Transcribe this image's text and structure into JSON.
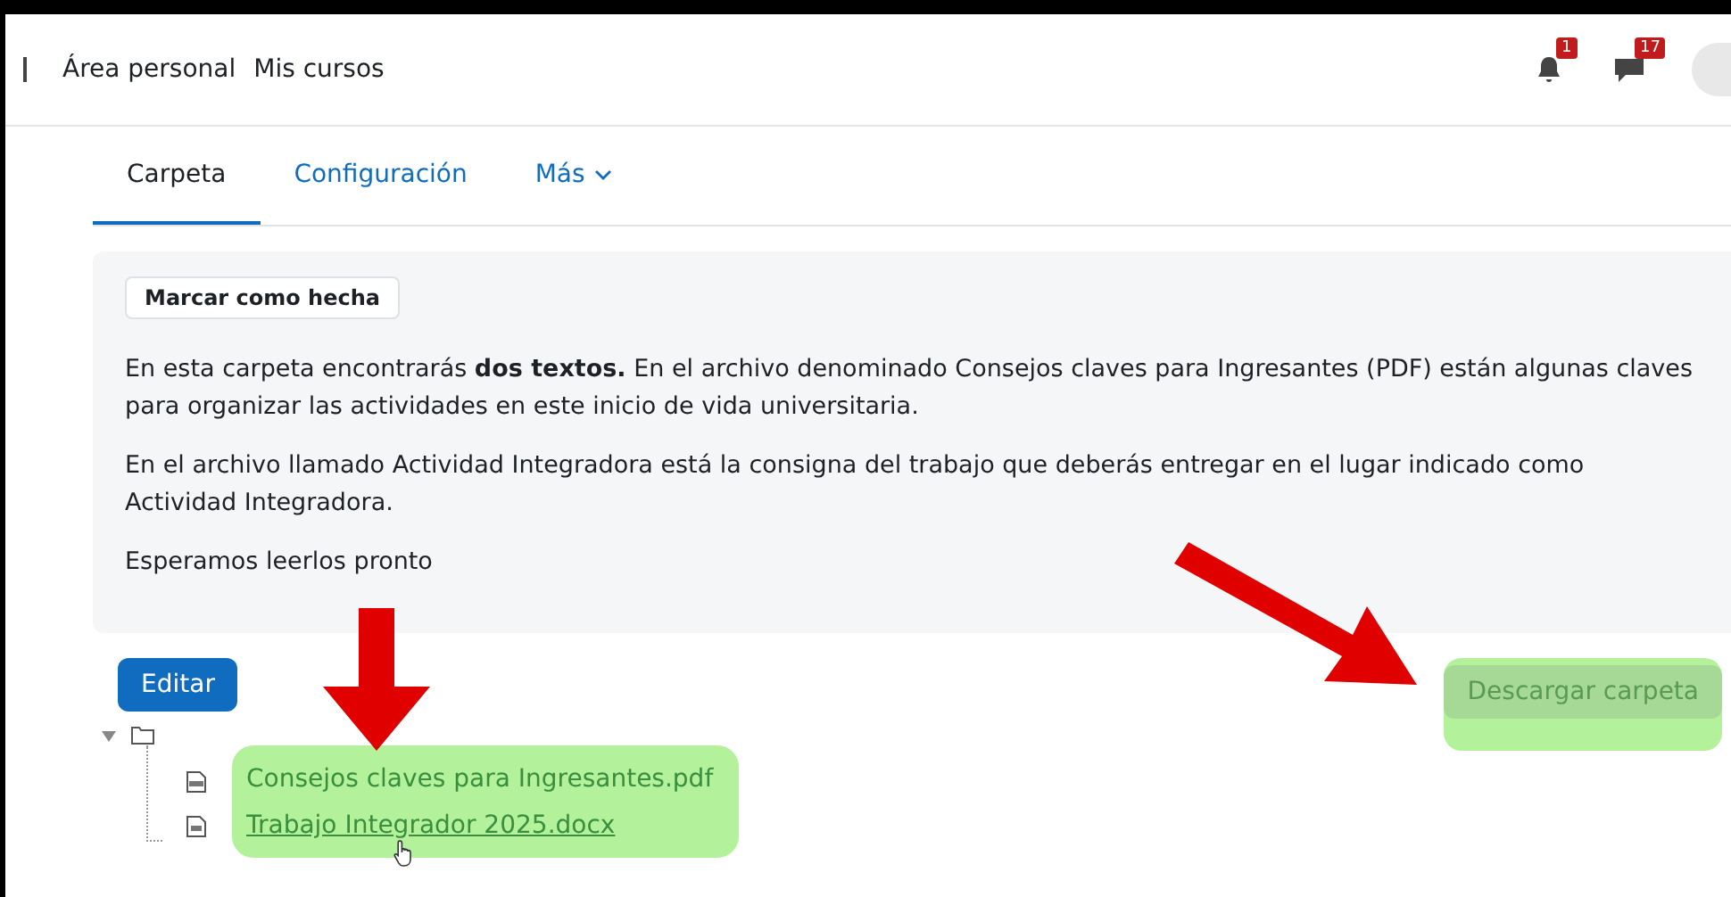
{
  "nav": {
    "links": [
      "Área personal",
      "Mis cursos"
    ],
    "notifications": {
      "count": "1"
    },
    "messages": {
      "count": "17"
    }
  },
  "tabs": [
    {
      "label": "Carpeta",
      "selected": true,
      "kind": "link"
    },
    {
      "label": "Configuración",
      "selected": false,
      "kind": "link"
    },
    {
      "label": "Más",
      "selected": false,
      "kind": "menu"
    }
  ],
  "mark_done_button": "Marcar como hecha",
  "description": [
    "En esta carpeta encontrarás **dos textos.** En el archivo denominado Consejos claves para Ingresantes (PDF) están algunas claves para organizar las actividades en este inicio de vida universitaria.",
    "En el archivo llamado Actividad Integradora está la consigna del trabajo que deberás entregar en el lugar indicado como Actividad Integradora.",
    "Esperamos leerlos pronto"
  ],
  "edit_button": "Editar",
  "download_button": "Descargar carpeta",
  "folder": {
    "expanded": true,
    "files": [
      {
        "name": "Consejos claves para Ingresantes.pdf",
        "kind": "pdf",
        "hovered": false
      },
      {
        "name": "Trabajo Integrador 2025.docx",
        "kind": "docx",
        "hovered": true
      }
    ]
  }
}
